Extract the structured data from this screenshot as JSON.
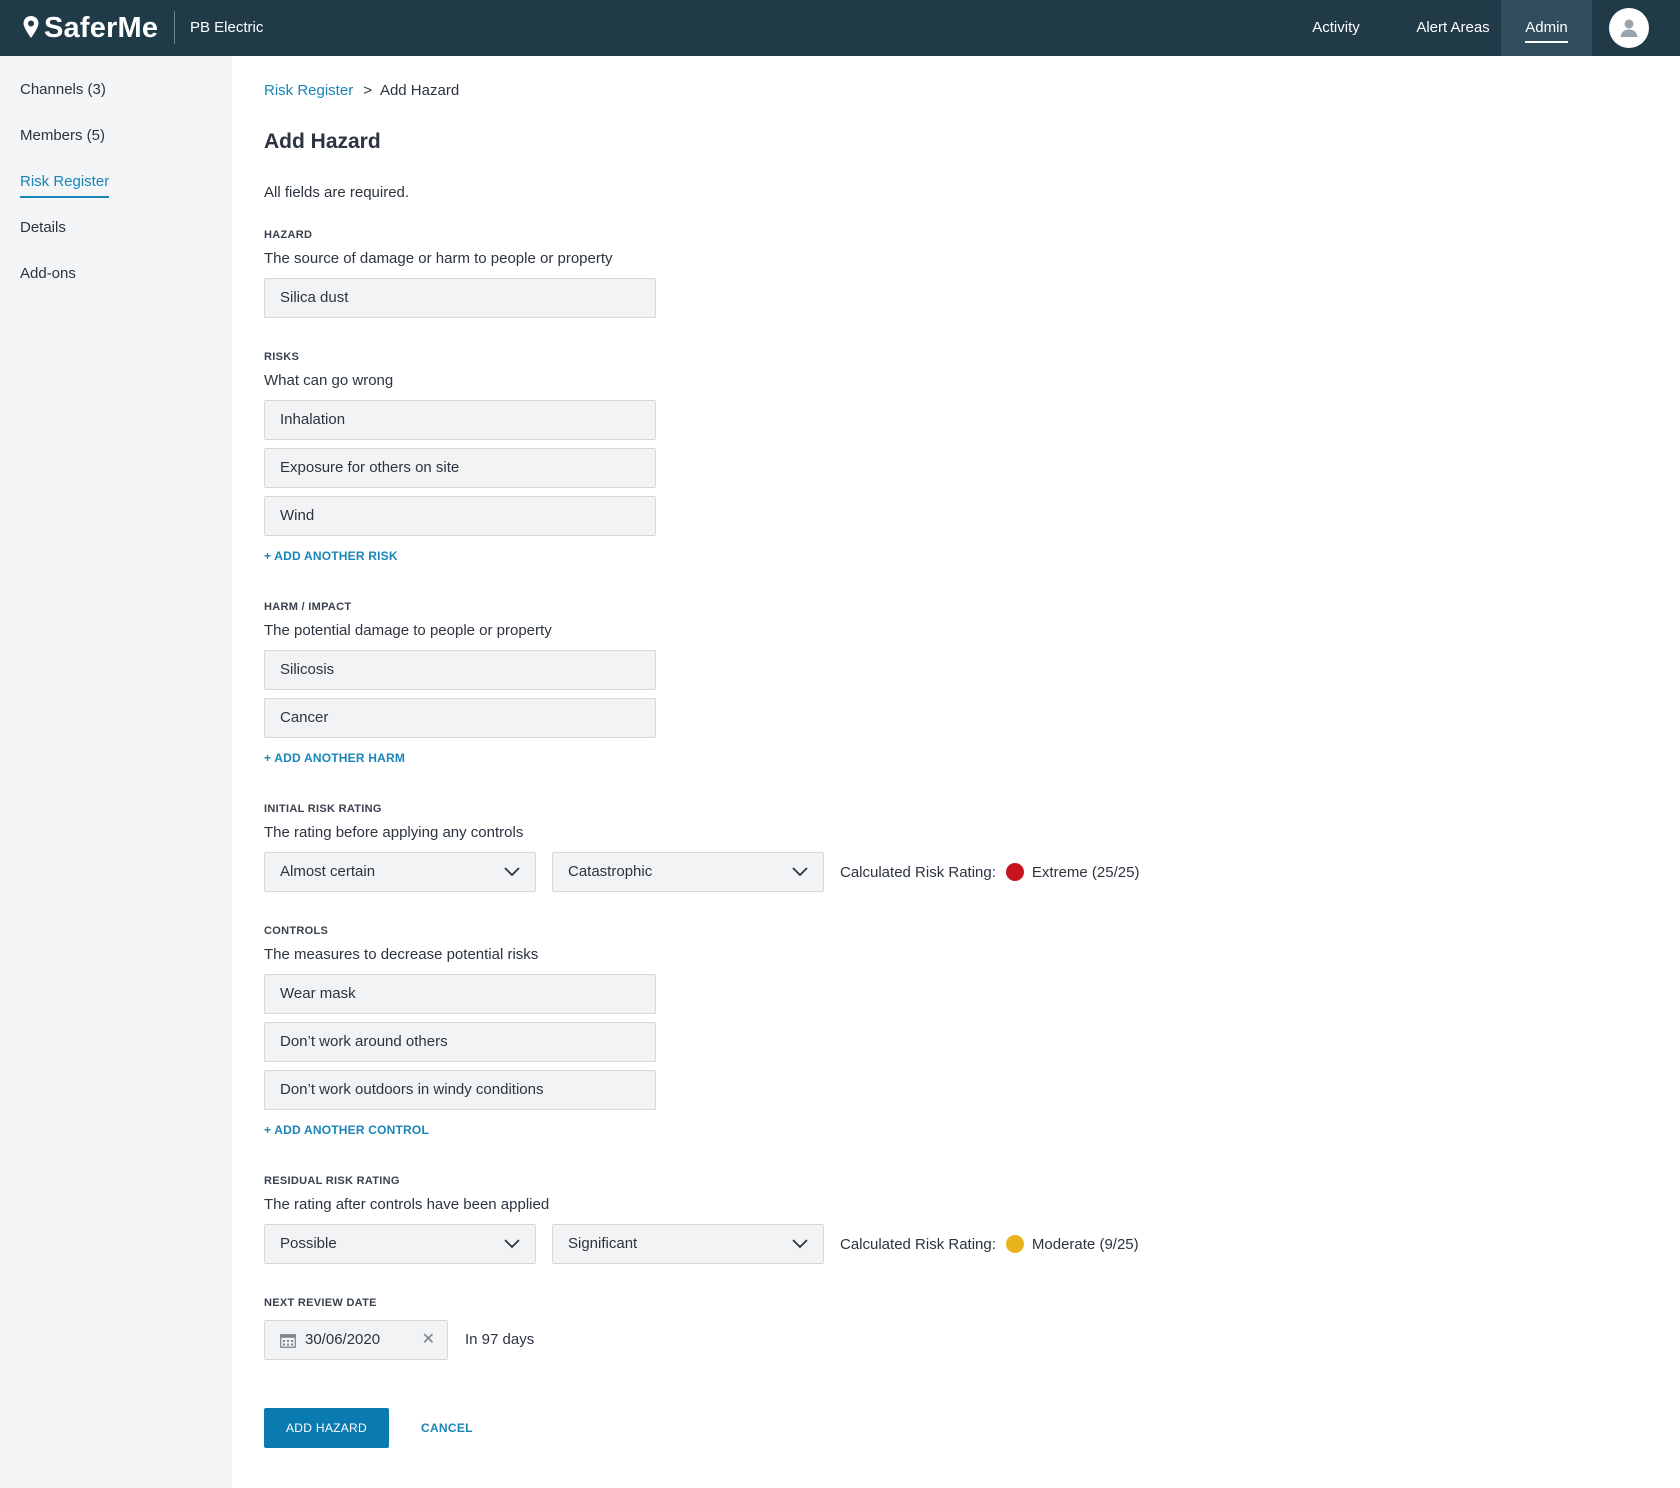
{
  "header": {
    "logo_text": "SaferMe",
    "org_name": "PB Electric",
    "nav": {
      "activity": "Activity",
      "alert_areas": "Alert Areas",
      "admin": "Admin"
    }
  },
  "sidebar": {
    "items": [
      {
        "label": "Channels (3)"
      },
      {
        "label": "Members (5)"
      },
      {
        "label": "Risk Register"
      },
      {
        "label": "Details"
      },
      {
        "label": "Add-ons"
      }
    ],
    "active": "Risk Register"
  },
  "breadcrumb": {
    "parent": "Risk Register",
    "separator": ">",
    "current": "Add Hazard"
  },
  "page": {
    "title": "Add Hazard",
    "note": "All fields are required."
  },
  "hazard": {
    "label": "HAZARD",
    "description": "The source of damage or harm to people or property",
    "value": "Silica dust"
  },
  "risks": {
    "label": "RISKS",
    "description": "What can go wrong",
    "values": [
      "Inhalation",
      "Exposure for others on site",
      "Wind"
    ],
    "add_label": "+ ADD ANOTHER RISK"
  },
  "harm": {
    "label": "HARM / IMPACT",
    "description": "The potential damage to people or property",
    "values": [
      "Silicosis",
      "Cancer"
    ],
    "add_label": "+ ADD ANOTHER HARM"
  },
  "initial_rating": {
    "label": "INITIAL RISK RATING",
    "description": "The rating before applying any controls",
    "likelihood": "Almost certain",
    "consequence": "Catastrophic",
    "calc_label": "Calculated Risk Rating:",
    "result": "Extreme (25/25)",
    "color": "#c8141e"
  },
  "controls": {
    "label": "CONTROLS",
    "description": "The measures to decrease potential risks",
    "values": [
      "Wear mask",
      "Don’t work around others",
      "Don’t work outdoors in windy conditions"
    ],
    "add_label": "+ ADD ANOTHER CONTROL"
  },
  "residual_rating": {
    "label": "RESIDUAL RISK RATING",
    "description": "The rating after controls have been applied",
    "likelihood": "Possible",
    "consequence": "Significant",
    "calc_label": "Calculated Risk Rating:",
    "result": "Moderate (9/25)",
    "color": "#e8b41e"
  },
  "review": {
    "label": "NEXT REVIEW DATE",
    "date": "30/06/2020",
    "clear": "✕",
    "relative": "In 97 days"
  },
  "actions": {
    "submit": "ADD HAZARD",
    "cancel": "CANCEL"
  },
  "colors": {
    "header_bg": "#203a48",
    "accent": "#1a85b8",
    "primary_button": "#0b7ab0"
  },
  "icons": [
    "location-pin-icon",
    "user-avatar-icon",
    "chevron-down-icon",
    "calendar-icon",
    "close-icon"
  ]
}
